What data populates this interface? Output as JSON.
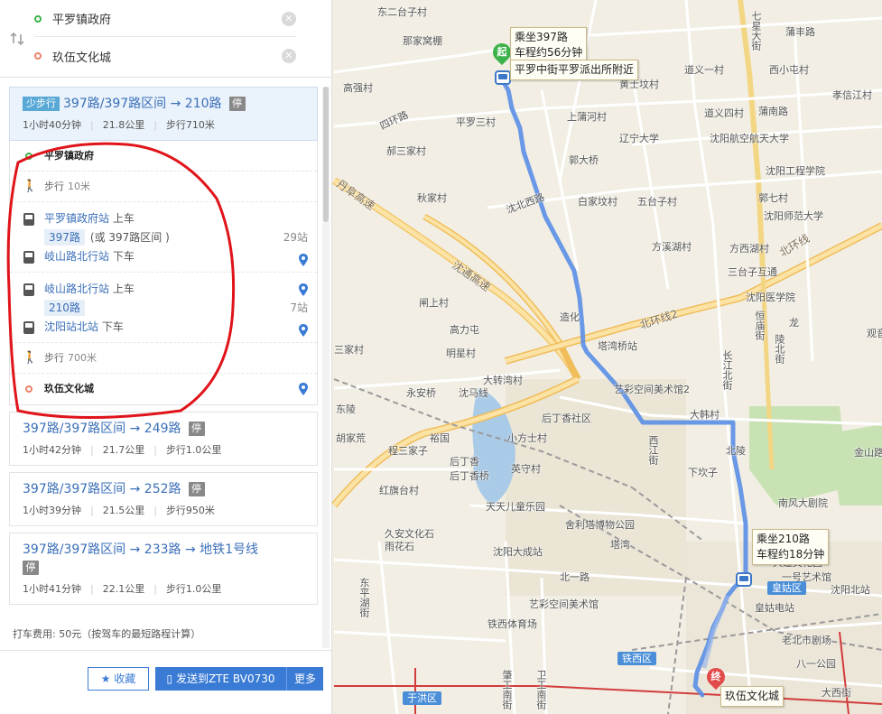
{
  "search": {
    "start": "平罗镇政府",
    "end": "玖伍文化城",
    "swap_icon": "swap-icon"
  },
  "plans": [
    {
      "walk_tag": "少步行",
      "title": "397路/397路区间 → 210路",
      "park": "停",
      "time": "1小时40分钟",
      "distance": "21.8公里",
      "walk": "步行710米"
    },
    {
      "title": "397路/397路区间 → 249路",
      "park": "停",
      "time": "1小时42分钟",
      "distance": "21.7公里",
      "walk": "步行1.0公里"
    },
    {
      "title": "397路/397路区间 → 252路",
      "park": "停",
      "time": "1小时39分钟",
      "distance": "21.5公里",
      "walk": "步行950米"
    },
    {
      "title": "397路/397路区间 → 233路 → 地铁1号线",
      "park": "停",
      "time": "1小时41分钟",
      "distance": "22.1公里",
      "walk": "步行1.0公里"
    }
  ],
  "detail": {
    "start": "平罗镇政府",
    "walk1_label": "步行",
    "walk1_len": "10米",
    "leg1": {
      "board_station": "平罗镇政府站",
      "board_action": "上车",
      "route": "397路",
      "alt": "(或 397路区间 )",
      "stops": "29站",
      "alight_station": "岐山路北行站",
      "alight_action": "下车"
    },
    "leg2": {
      "board_station": "岐山路北行站",
      "board_action": "上车",
      "route": "210路",
      "stops": "7站",
      "alight_station": "沈阳站北站",
      "alight_action": "下车"
    },
    "walk2_label": "步行",
    "walk2_len": "700米",
    "end": "玖伍文化城"
  },
  "fare": "打车费用: 50元（按驾车的最短路程计算）",
  "footer": {
    "fav": "收藏",
    "send": "发送到ZTE BV0730",
    "more": "更多"
  },
  "map": {
    "callout_start_line1": "乘坐397路",
    "callout_start_line2": "车程约56分钟",
    "callout_start_stop": "平罗中街平罗派出所附近",
    "callout_mid_line1": "乘坐210路",
    "callout_mid_line2": "车程约18分钟",
    "callout_end": "玖伍文化城",
    "start_marker": "起",
    "end_marker": "终",
    "labels": {
      "l1": "东二台子村",
      "l2": "那家窝棚",
      "l3": "高强村",
      "l4": "平罗三村",
      "l5": "郝三家村",
      "l6": "秋家村",
      "l7": "四环路",
      "l8": "丹阜高速",
      "l9": "沈通高速",
      "l10": "闸上村",
      "l11": "高力屯",
      "l12": "明星村",
      "l13": "三家村",
      "l14": "永安桥",
      "l15": "沈马线",
      "l16": "大转湾村",
      "l17": "东陵",
      "l18": "胡家荒",
      "l19": "程三家子",
      "l20": "裕国",
      "l21": "后丁香",
      "l22": "后丁香桥",
      "l23": "红旗台村",
      "l24": "天天儿童乐园",
      "l25": "久安文化石",
      "l26": "雨花石",
      "l27": "东平湖街",
      "l28": "沈阳大成站",
      "l29": "铁西体育场",
      "l30": "肇工南街",
      "l31": "卫工南街",
      "l32": "铁西区",
      "l33": "于洪区",
      "l34": "艺彩空间美术馆",
      "l35": "北一路",
      "l36": "塔湾",
      "l37": "舍利塔博物公园",
      "l38": "英守村",
      "l39": "小方士村",
      "l40": "后丁香社区",
      "l41": "塔湾桥站",
      "l42": "造化",
      "l43": "沈北西路",
      "l44": "白家坟村",
      "l45": "五台子村",
      "l46": "方溪湖村",
      "l47": "方西湖村",
      "l48": "上蒲河村",
      "l49": "辽宁大学",
      "l50": "郭大桥",
      "l51": "黄士坟村",
      "l52": "道义一村",
      "l53": "道义四村",
      "l54": "沈阳航空航天大学",
      "l55": "沈阳工程学院",
      "l56": "郭七村",
      "l57": "沈阳师范大学",
      "l58": "三台子互通",
      "l59": "北环线",
      "l60": "沈阳医学院",
      "l61": "长江北街",
      "l62": "陵北街",
      "l63": "大韩村",
      "l64": "北陵",
      "l65": "下坎子",
      "l66": "西江街",
      "l67": "南风大剧院",
      "l68": "大道文化园",
      "l69": "一号艺术馆",
      "l70": "皇姑区",
      "l71": "沈阳北站",
      "l72": "皇姑电站",
      "l73": "老北市剧场",
      "l74": "八一公园",
      "l75": "大西街",
      "l76": "七星大街",
      "l77": "蒲丰路",
      "l78": "西小屯村",
      "l79": "蒲南路",
      "l80": "孝信江村",
      "l81": "金山路",
      "l82": "观音",
      "l83": "恒庙街",
      "l84": "龙",
      "l85": "北环线2",
      "l86": "艺彩空间美术馆2"
    }
  },
  "colors": {
    "accent": "#3a7bd5",
    "route": "#5a8ee6",
    "start": "#3cb34a",
    "end": "#e24b4b",
    "annotation": "#e0141b"
  }
}
